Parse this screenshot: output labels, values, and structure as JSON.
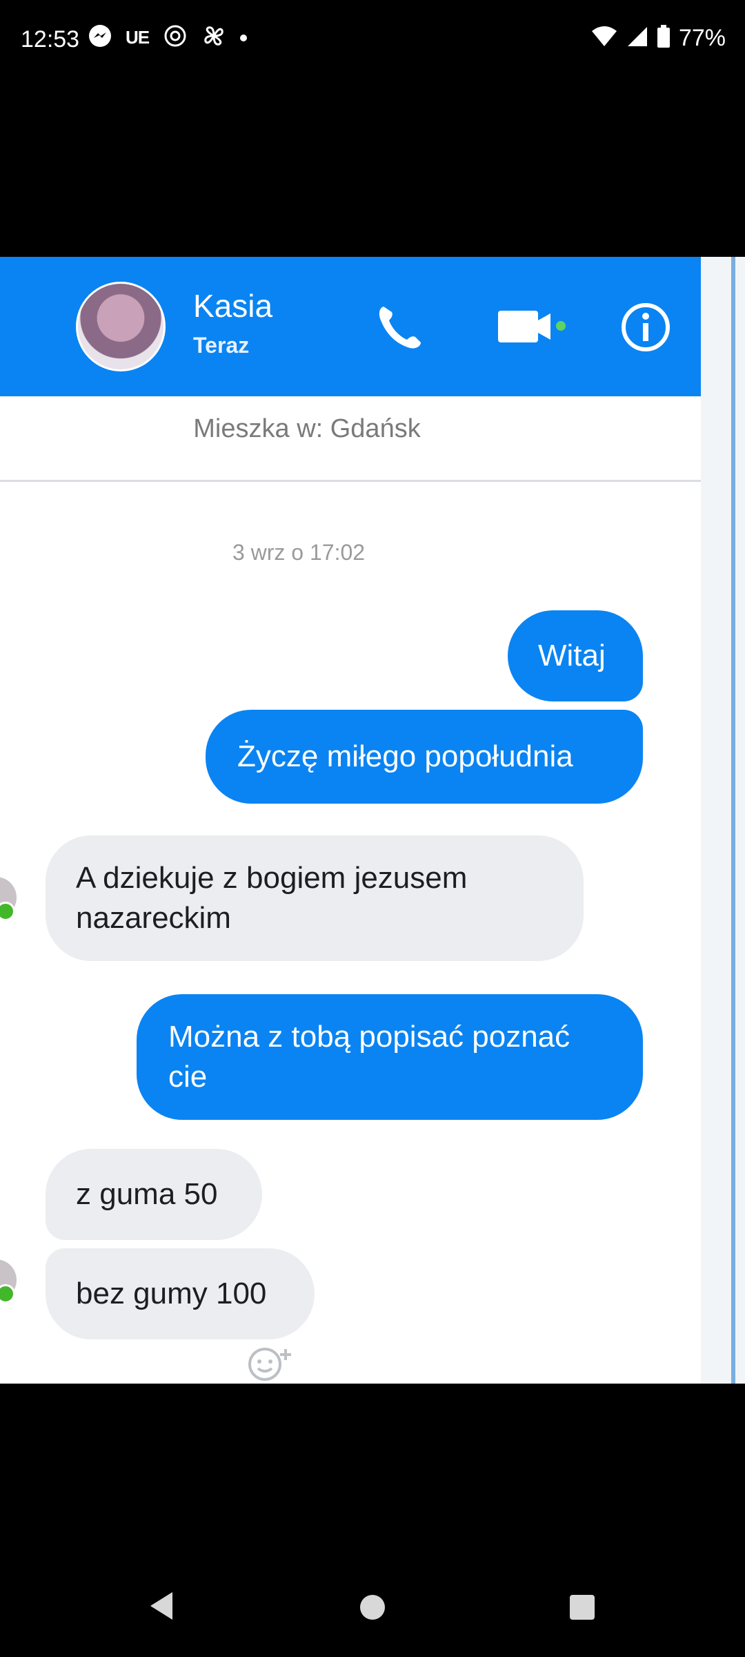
{
  "status_bar": {
    "time": "12:53",
    "carrier_tag": "UE",
    "battery": "77%",
    "icons_left": [
      "messenger-icon",
      "ue-text",
      "openai-icon",
      "pinwheel-icon",
      "notification-dot"
    ],
    "icons_right": [
      "wifi-icon",
      "signal-icon",
      "battery-icon"
    ]
  },
  "chat": {
    "contact_name": "Kasia",
    "contact_status": "Teraz",
    "header_icons": [
      "phone-icon",
      "video-icon",
      "info-icon"
    ],
    "lives_in": "Mieszka w: Gdańsk",
    "date_separator": "3 wrz o 17:02",
    "messages": [
      {
        "side": "out",
        "text": "Witaj"
      },
      {
        "side": "out",
        "text": "Życzę miłego popołudnia"
      },
      {
        "side": "in",
        "text": "A dziekuje z bogiem jezusem nazareckim"
      },
      {
        "side": "out",
        "text": "Można z tobą popisać poznać cie"
      },
      {
        "side": "in",
        "text": "z guma 50"
      },
      {
        "side": "in",
        "text": "bez gumy 100"
      }
    ]
  },
  "colors": {
    "accent": "#0a84f2",
    "incoming_bubble": "#ebedf0",
    "online": "#42b72a"
  },
  "nav_bar": {
    "buttons": [
      "back-button",
      "home-button",
      "recents-button"
    ]
  }
}
